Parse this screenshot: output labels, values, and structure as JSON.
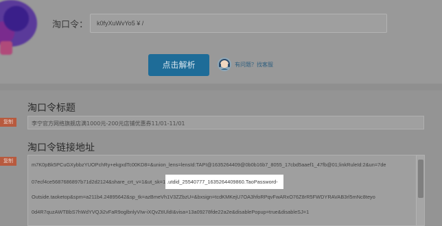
{
  "parser": {
    "label": "淘口令：",
    "input_value": "k0fyXuWvYo5 ¥ /",
    "parse_button": "点击解析",
    "help_text": "有问题？找客服"
  },
  "result": {
    "title_heading": "淘口令标题",
    "copy_label": "复制",
    "title_value": "李宁官方网络旗舰店满1000元-200元店铺优惠券11/01-11/01",
    "link_heading": "淘口令链接地址",
    "link_lines": {
      "line1": "m7K0pBk5PCuGXybbzYUOPchRy+ekgxdTc00KD8=&union_lens=lensId:TAPI@1635264409@0b0b16b7_8055_17cbd5aaef1_47fb@01;linkRuleId:2&un=7de",
      "line2_before": "07ecf4ce5687686897b71d2d2124&share_crt_v=1&ut_sk=1",
      "line2_highlight": ".utdid_25540777_1635264409860.TaoPassword-",
      "line3": "Outside.taoketop&spm=a211b4.24895642&sp_tk=azBmeVh1V3ZZbzU=&bxsign=tcdKMKejU7OA3hfoRPqvFwARxO76Z8rR5FWDYRAVAB3rl5mNc8teyo",
      "line4": "0d4R7quzAWTBbS7hWdYVQJi2vFaR9oglbnlyVIw-iXQvZtIUldI&visa=13a09278fde22a2e&disablePopup=true&disableSJ=1"
    }
  },
  "colors": {
    "parse_button": "#1e6c98",
    "copy_button": "#b85a3e",
    "highlight": "#ffffff"
  }
}
